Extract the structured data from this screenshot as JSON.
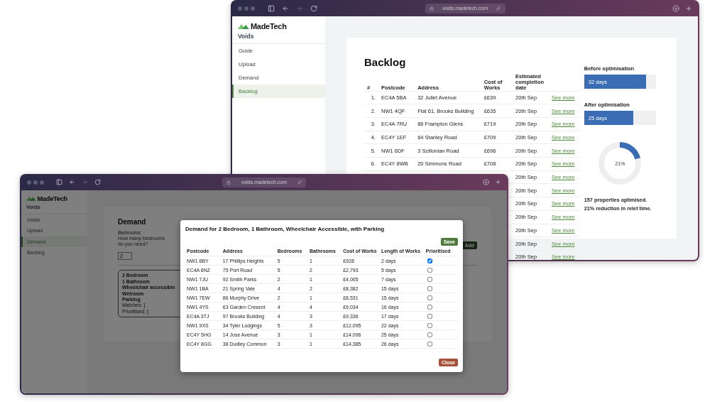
{
  "backlog_window": {
    "url": "voids.madetech.com",
    "logo": "MadeTech",
    "app_name": "Voids",
    "nav": [
      {
        "label": "Guide",
        "selected": false
      },
      {
        "label": "Upload",
        "selected": false
      },
      {
        "label": "Demand",
        "selected": false
      },
      {
        "label": "Backlog",
        "selected": true
      }
    ],
    "title": "Backlog",
    "columns": [
      "#",
      "Postcode",
      "Address",
      "Cost of Works",
      "Estimated completion date"
    ],
    "rows": [
      {
        "number": "1.",
        "postcode": "EC4A 5BA",
        "address": "32 Juliet Avenue",
        "cost": "£639",
        "date": "20th Sep",
        "link": "See more"
      },
      {
        "number": "2.",
        "postcode": "NW1 4QF",
        "address": "Flat 61, Brooks Building",
        "cost": "£635",
        "date": "20th Sep",
        "link": "See more"
      },
      {
        "number": "3.",
        "postcode": "EC4A 7RU",
        "address": "86 Frampton Glens",
        "cost": "£719",
        "date": "20th Sep",
        "link": "See more"
      },
      {
        "number": "4.",
        "postcode": "EC4Y 1EF",
        "address": "64 Stanley Road",
        "cost": "£709",
        "date": "20th Sep",
        "link": "See more"
      },
      {
        "number": "5.",
        "postcode": "NW1 6DF",
        "address": "3 Scillonian Road",
        "cost": "£696",
        "date": "20th Sep",
        "link": "See more"
      },
      {
        "number": "6.",
        "postcode": "EC4Y 8WB",
        "address": "20 Simmons Road",
        "cost": "£708",
        "date": "20th Sep",
        "link": "See more"
      },
      {
        "date": "20th Sep",
        "link": "See more"
      },
      {
        "date": "20th Sep",
        "link": "See more"
      },
      {
        "date": "20th Sep",
        "link": "See more"
      },
      {
        "date": "20th Sep",
        "link": "See more"
      },
      {
        "date": "20th Sep",
        "link": "See more"
      },
      {
        "date": "20th Sep",
        "link": "See more"
      },
      {
        "date": "20th Sep",
        "link": "See more"
      }
    ],
    "stats": [
      {
        "label": "Before optimisation",
        "reading": "32 days",
        "level": 0.86
      },
      {
        "label": "After optimisation",
        "reading": "25 days",
        "level": 0.68
      }
    ],
    "donut": {
      "reading": "21%",
      "chart_data": {
        "type": "donut",
        "values": [
          21,
          79
        ]
      }
    },
    "summary": [
      "157 properties optimised.",
      "21% reduction in relet time."
    ]
  },
  "demand_window": {
    "url": "voids.madetech.com",
    "logo": "MadeTech",
    "app_name": "Voids",
    "nav": [
      {
        "label": "Guide",
        "selected": false
      },
      {
        "label": "Upload",
        "selected": false
      },
      {
        "label": "Demand",
        "selected": true
      },
      {
        "label": "Backlog",
        "selected": false
      }
    ],
    "title": "Demand",
    "field_label": "Bedrooms",
    "field_hint": "How many bedrooms do you need?",
    "field_value": "2",
    "add_button": "Add",
    "criteria": [
      "2 Bedroom",
      "1 Bathroom",
      "Wheelchair accessible",
      "Wetroom",
      "Parking"
    ],
    "counts": [
      "Matches: ]",
      "Prioritised: ]"
    ],
    "modal": {
      "title": "Demand for 2 Bedroom, 1 Bathroom, Wheelchair Accessible, with Parking",
      "save_button": "Save",
      "close_button": "Close",
      "columns": [
        "Postcode",
        "Address",
        "Bedrooms",
        "Bathrooms",
        "Cost of Works",
        "Length of Works",
        "Prioritised"
      ],
      "rows": [
        {
          "postcode": "NW1 8BY",
          "address": "17 Phillips Heights",
          "bedrooms": "5",
          "bathrooms": "1",
          "cost": "£928",
          "length": "2 days",
          "checked": true
        },
        {
          "postcode": "EC4A 6NZ",
          "address": "75 Port Road",
          "bedrooms": "5",
          "bathrooms": "2",
          "cost": "£2,793",
          "length": "5 days",
          "checked": false
        },
        {
          "postcode": "NW1 7JU",
          "address": "92 Smith Parks",
          "bedrooms": "2",
          "bathrooms": "1",
          "cost": "£4,005",
          "length": "7 days",
          "checked": false
        },
        {
          "postcode": "NW1 1BA",
          "address": "21 Spring Vale",
          "bedrooms": "4",
          "bathrooms": "2",
          "cost": "£8,382",
          "length": "15 days",
          "checked": false
        },
        {
          "postcode": "NW1 7EW",
          "address": "86 Murphy Drive",
          "bedrooms": "2",
          "bathrooms": "1",
          "cost": "£8,531",
          "length": "15 days",
          "checked": false
        },
        {
          "postcode": "NW1 4YS",
          "address": "63 Garden Cresent",
          "bedrooms": "4",
          "bathrooms": "4",
          "cost": "£9,034",
          "length": "16 days",
          "checked": false
        },
        {
          "postcode": "EC4A 3TJ",
          "address": "97 Brooks Building",
          "bedrooms": "4",
          "bathrooms": "3",
          "cost": "£9,336",
          "length": "17 days",
          "checked": false
        },
        {
          "postcode": "NW1 9XS",
          "address": "34 Tyler Lodgings",
          "bedrooms": "5",
          "bathrooms": "3",
          "cost": "£12,095",
          "length": "22 days",
          "checked": false
        },
        {
          "postcode": "EC4Y 5HG",
          "address": "14 Jose Avenue",
          "bedrooms": "3",
          "bathrooms": "1",
          "cost": "£14,096",
          "length": "25 days",
          "checked": false
        },
        {
          "postcode": "EC4Y 8GG",
          "address": "38 Dudley Common",
          "bedrooms": "3",
          "bathrooms": "1",
          "cost": "£14,385",
          "length": "26 days",
          "checked": false
        }
      ]
    }
  }
}
